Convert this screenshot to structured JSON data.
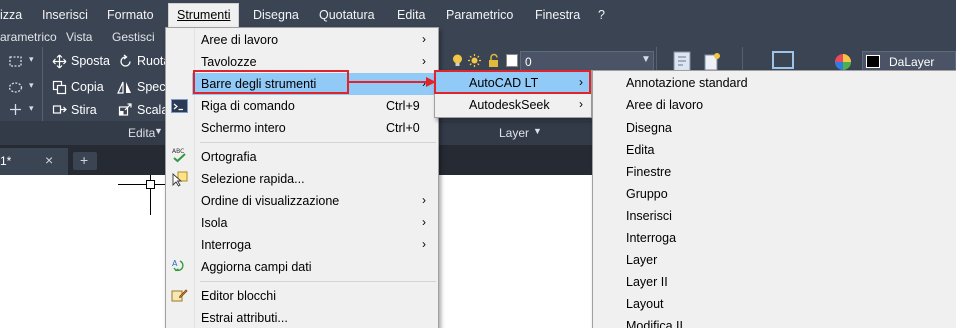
{
  "menubar": {
    "items": [
      "izza",
      "Inserisci",
      "Formato",
      "Strumenti",
      "Disegna",
      "Quotatura",
      "Edita",
      "Parametrico",
      "Finestra",
      "?"
    ]
  },
  "ribbon_tabs": [
    "arametrico",
    "Vista",
    "Gestisci"
  ],
  "ribbon": {
    "modify": {
      "move": "Sposta",
      "rotate": "Ruota",
      "copy": "Copia",
      "mirror": "Specc",
      "stretch": "Stira",
      "scale": "Scala"
    },
    "layer_value": "0",
    "color_value": "DaLayer",
    "panel_modify": "Edita",
    "panel_layer": "Layer"
  },
  "doc_tab": {
    "name": "1*",
    "close": "×",
    "add": "+"
  },
  "strumenti_menu": {
    "items": [
      {
        "label": "Aree di lavoro",
        "submenu": true
      },
      {
        "label": "Tavolozze",
        "submenu": true
      },
      {
        "label": "Barre degli strumenti",
        "submenu": true,
        "highlighted": true
      },
      {
        "label": "Riga di comando",
        "shortcut": "Ctrl+9",
        "icon": "command-line-icon"
      },
      {
        "label": "Schermo intero",
        "shortcut": "Ctrl+0"
      },
      {
        "label": "Ortografia",
        "icon": "spellcheck-icon"
      },
      {
        "label": "Selezione rapida...",
        "icon": "quick-select-icon"
      },
      {
        "label": "Ordine di visualizzazione",
        "submenu": true
      },
      {
        "label": "Isola",
        "submenu": true
      },
      {
        "label": "Interroga",
        "submenu": true
      },
      {
        "label": "Aggiorna campi dati",
        "icon": "update-fields-icon"
      },
      {
        "label": "Editor blocchi",
        "icon": "block-editor-icon"
      },
      {
        "label": "Estrai attributi..."
      }
    ]
  },
  "toolbars_submenu": {
    "items": [
      {
        "label": "AutoCAD LT",
        "submenu": true,
        "highlighted": true
      },
      {
        "label": "AutodeskSeek",
        "submenu": true
      }
    ]
  },
  "autocad_submenu": {
    "items": [
      "Annotazione standard",
      "Aree di lavoro",
      "Disegna",
      "Edita",
      "Finestre",
      "Gruppo",
      "Inserisci",
      "Interroga",
      "Layer",
      "Layer II",
      "Layout",
      "Modifica II"
    ]
  },
  "colors": {
    "highlight": "#91c9f7",
    "annotation": "#e0242a",
    "ribbon": "#3b4453"
  }
}
